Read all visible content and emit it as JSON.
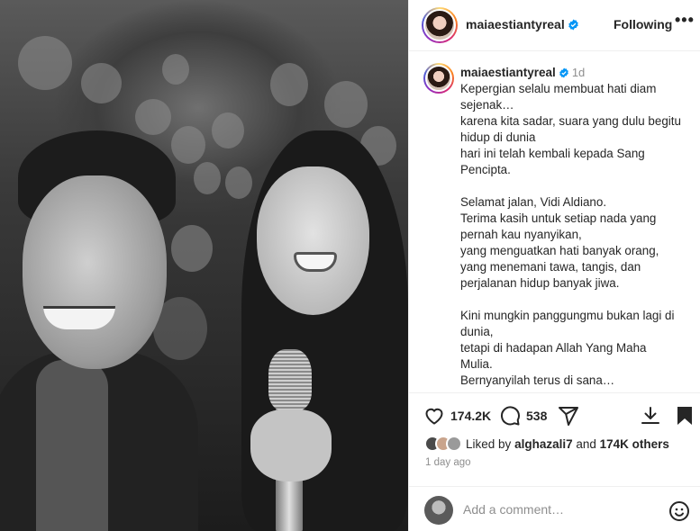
{
  "header": {
    "username": "maiaestiantyreal",
    "follow_label": "Following",
    "more_label": "•••"
  },
  "post": {
    "username": "maiaestiantyreal",
    "time_ago": "1d",
    "caption_paragraphs": [
      [
        "Kepergian selalu membuat hati diam sejenak…",
        "karena kita sadar, suara yang dulu begitu hidup di dunia",
        "hari ini telah kembali kepada Sang Pencipta."
      ],
      [
        "Selamat jalan, Vidi Aldiano.",
        "Terima kasih untuk setiap nada yang pernah kau nyanyikan,",
        "yang menguatkan hati banyak orang,",
        "yang menemani tawa, tangis, dan perjalanan hidup banyak jiwa."
      ],
      [
        "Kini mungkin panggungmu bukan lagi di dunia,",
        "tetapi di hadapan Allah Yang Maha Mulia.",
        "Bernyanyilah terus di sana…"
      ]
    ]
  },
  "actions": {
    "like_count": "174.2K",
    "comment_count": "538"
  },
  "likes": {
    "prefix": "Liked by",
    "user": "alghazali7",
    "connector": "and",
    "others": "174K others"
  },
  "posted": "1 day ago",
  "comment_box": {
    "placeholder": "Add a comment…"
  },
  "colors": {
    "verified": "#0095f6",
    "text": "#262626",
    "muted": "#8e8e8e",
    "divider": "#efefef"
  },
  "icons": [
    "verified-badge-icon",
    "more-icon",
    "heart-icon",
    "comment-icon",
    "share-icon",
    "download-icon",
    "bookmark-icon",
    "emoji-icon"
  ]
}
